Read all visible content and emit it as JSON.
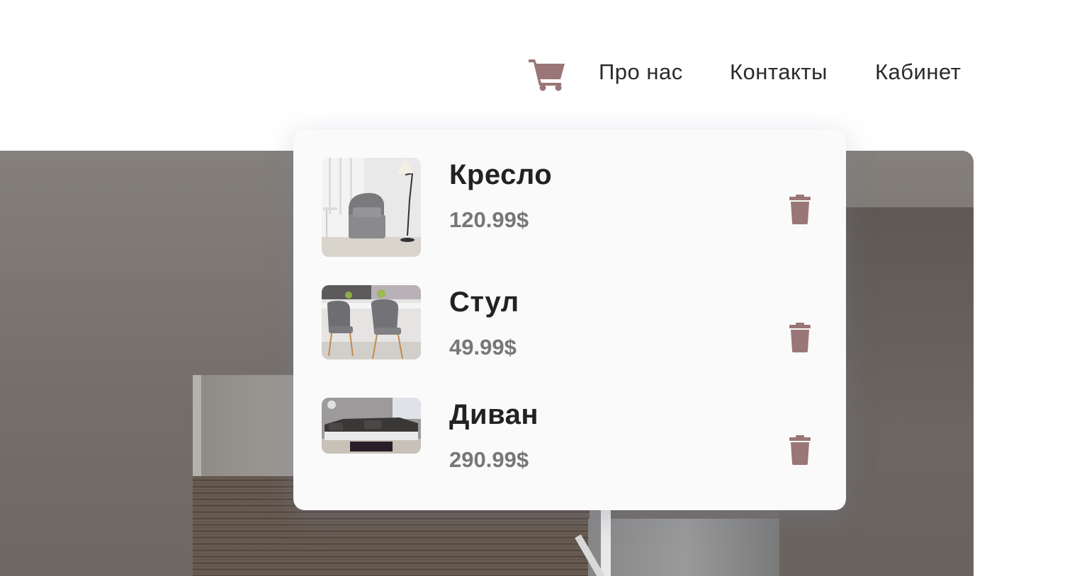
{
  "header": {
    "cart_icon": "shopping-cart-icon",
    "nav": [
      {
        "label": "Про нас"
      },
      {
        "label": "Контакты"
      },
      {
        "label": "Кабинет"
      }
    ]
  },
  "cart": {
    "items": [
      {
        "name": "Кресло",
        "price": "120.99$",
        "image": "armchair-photo"
      },
      {
        "name": "Стул",
        "price": "49.99$",
        "image": "chairs-photo"
      },
      {
        "name": "Диван",
        "price": "290.99$",
        "image": "sofa-photo"
      }
    ],
    "delete_icon": "trash-icon"
  },
  "colors": {
    "accent": "#9b7676",
    "text": "#2a2a2a",
    "price": "#777777",
    "popup_bg": "#fafafa"
  }
}
